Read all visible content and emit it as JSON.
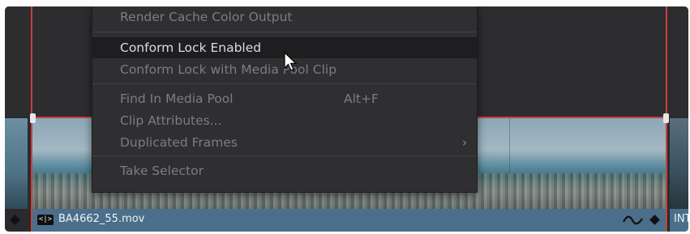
{
  "menu": {
    "items": [
      {
        "label": "Render Cache Color Output",
        "enabled": false
      },
      {
        "label": "Conform Lock Enabled",
        "enabled": true,
        "hovered": true
      },
      {
        "label": "Conform Lock with Media Pool Clip",
        "enabled": false
      },
      {
        "label": "Find In Media Pool",
        "shortcut": "Alt+F",
        "enabled": false
      },
      {
        "label": "Clip Attributes...",
        "enabled": false
      },
      {
        "label": "Duplicated Frames",
        "has_submenu": true,
        "enabled": false
      },
      {
        "label": "Take Selector",
        "enabled": false
      }
    ],
    "submenu_icon": "chevron-right-icon"
  },
  "timeline": {
    "clip_name": "BA4662_55.mov",
    "clip_type_icon": "video-clip-icon",
    "next_clip_label": "INT",
    "keyframe_icon": "diamond-icon",
    "curve_icon": "curve-icon"
  },
  "colors": {
    "selection_border": "#c9403d",
    "clip_bar": "#4b6f8a",
    "menu_bg": "#2f2f31",
    "menu_text_enabled": "#dcdcde",
    "menu_text_disabled": "#7d7d80"
  }
}
